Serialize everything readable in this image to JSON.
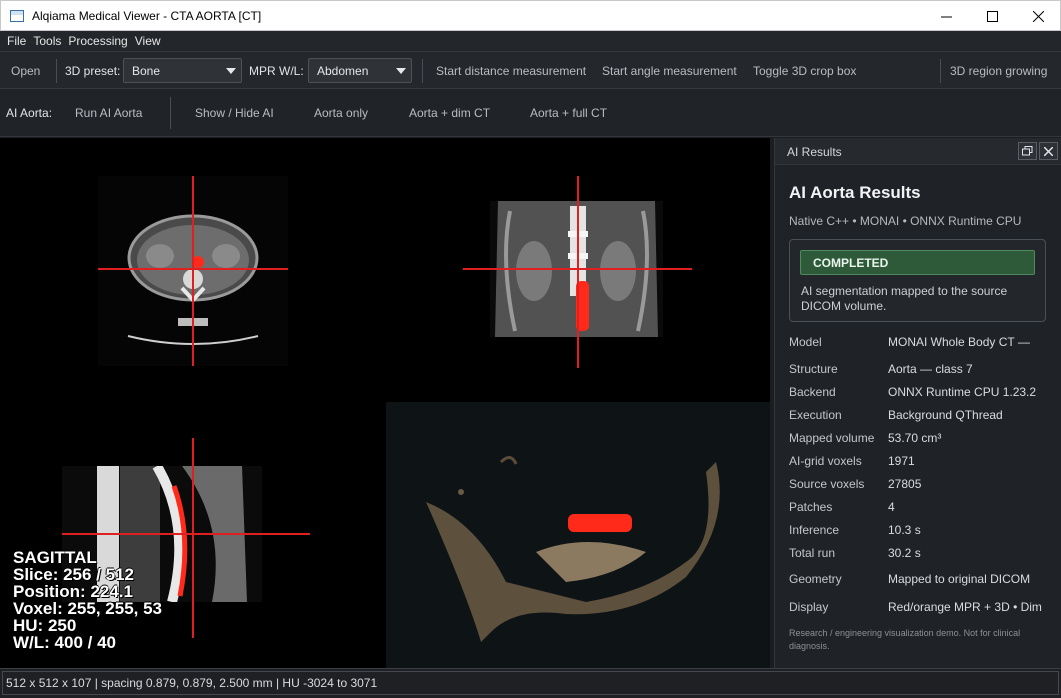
{
  "window": {
    "title": "Alqiama Medical Viewer - CTA AORTA [CT]"
  },
  "menu": [
    "File",
    "Tools",
    "Processing",
    "View"
  ],
  "toolbar1": {
    "open": "Open",
    "preset_label": "3D preset:",
    "preset_value": "Bone",
    "mpr_label": "MPR W/L:",
    "mpr_value": "Abdomen",
    "distance": "Start distance measurement",
    "angle": "Start angle measurement",
    "crop": "Toggle 3D crop box",
    "region": "3D region growing"
  },
  "toolbar2": {
    "label": "AI Aorta:",
    "run": "Run AI Aorta",
    "show_hide": "Show / Hide AI",
    "aorta_only": "Aorta only",
    "aorta_dim": "Aorta + dim CT",
    "aorta_full": "Aorta + full CT"
  },
  "overlay": {
    "view": "SAGITTAL",
    "slice": "Slice: 256 / 512",
    "position": "Position: 224.1",
    "voxel": "Voxel: 255, 255, 53",
    "hu": "HU: 250",
    "wl": "W/L: 400 / 40"
  },
  "panel": {
    "header": "AI Results",
    "title": "AI Aorta Results",
    "subtitle": "Native C++ • MONAI • ONNX Runtime CPU",
    "status": "COMPLETED",
    "status_message": "AI segmentation mapped to the source DICOM volume.",
    "rows": [
      {
        "k": "Model",
        "v": "MONAI Whole Body CT —"
      },
      {
        "k": "Structure",
        "v": "Aorta — class 7"
      },
      {
        "k": "Backend",
        "v": "ONNX Runtime CPU 1.23.2"
      },
      {
        "k": "Execution",
        "v": "Background QThread"
      },
      {
        "k": "Mapped volume",
        "v": "53.70 cm³"
      },
      {
        "k": "AI-grid voxels",
        "v": "1971"
      },
      {
        "k": "Source voxels",
        "v": "27805"
      },
      {
        "k": "Patches",
        "v": "4"
      },
      {
        "k": "Inference",
        "v": "10.3 s"
      },
      {
        "k": "Total run",
        "v": "30.2 s"
      },
      {
        "k": "Geometry",
        "v": "Mapped to original DICOM"
      },
      {
        "k": "Display",
        "v": "Red/orange MPR + 3D • Dim"
      }
    ],
    "disclaimer": "Research / engineering visualization demo. Not for clinical diagnosis."
  },
  "statusbar": "512 x 512 x 107 | spacing 0.879, 0.879, 2.500 mm | HU -3024 to 3071",
  "colors": {
    "crosshair": "#e02020",
    "segmentation": "#ff2a1a",
    "accent_green": "#2e5a3a"
  }
}
